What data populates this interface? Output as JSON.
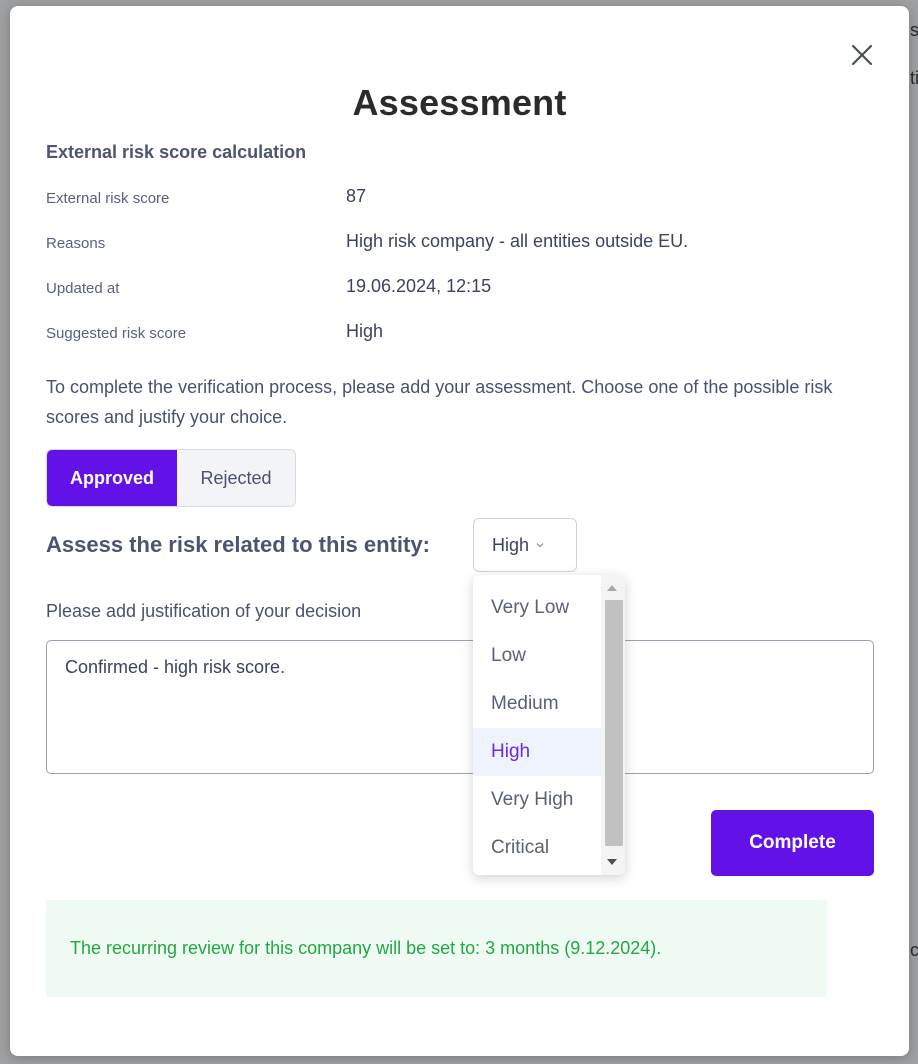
{
  "background": {
    "fragments": [
      "s",
      "ti",
      "c"
    ]
  },
  "modal": {
    "title": "Assessment",
    "close_icon": "close-icon",
    "section_title": "External risk score calculation",
    "info": [
      {
        "label": "External risk score",
        "value": "87"
      },
      {
        "label": "Reasons",
        "value": "High risk company - all entities outside EU."
      },
      {
        "label": "Updated at",
        "value": "19.06.2024, 12:15"
      },
      {
        "label": "Suggested risk score",
        "value": "High"
      }
    ],
    "instructions": "To complete the verification process, please add your assessment. Choose one of the possible risk scores and justify your choice.",
    "decision": {
      "approved_label": "Approved",
      "rejected_label": "Rejected",
      "selected": "Approved"
    },
    "risk": {
      "label": "Assess the risk related to this entity:",
      "selected": "High",
      "options": [
        "Very Low",
        "Low",
        "Medium",
        "High",
        "Very High",
        "Critical"
      ]
    },
    "justification": {
      "label": "Please add justification of your decision",
      "value": "Confirmed - high risk score."
    },
    "complete_label": "Complete",
    "notice": "The recurring review for this company will be set to: 3 months (9.12.2024)."
  },
  "colors": {
    "accent": "#6212e6",
    "notice_text": "#22a744",
    "notice_bg": "#effbf2",
    "selected_option": "#6a2be8"
  }
}
